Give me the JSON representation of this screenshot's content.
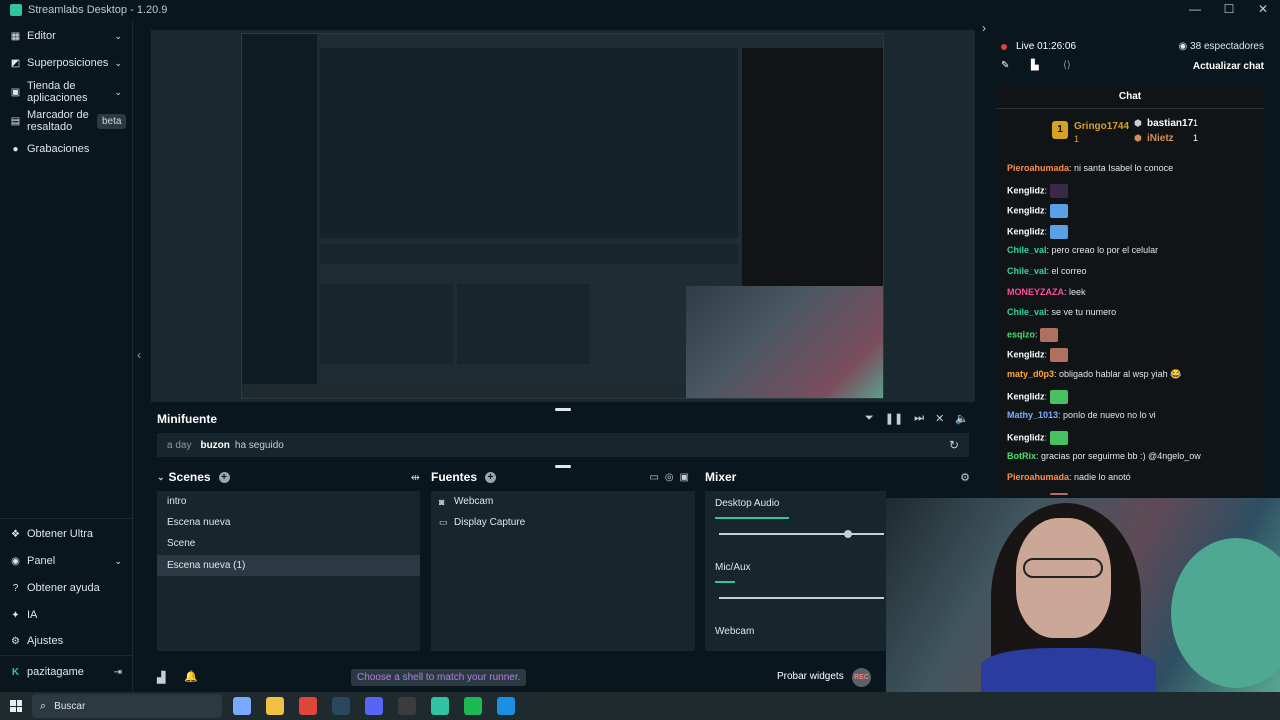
{
  "window": {
    "title": "Streamlabs Desktop - 1.20.9",
    "controls": [
      "—",
      "☐",
      "✕"
    ]
  },
  "sidebar": {
    "items": [
      {
        "label": "Editor",
        "icon": "grid-icon",
        "has_chevron": true
      },
      {
        "label": "Superposiciones",
        "icon": "overlay-icon",
        "has_chevron": true
      },
      {
        "label": "Tienda de aplicaciones",
        "icon": "store-icon",
        "has_chevron": true
      },
      {
        "label": "Marcador de resaltado",
        "icon": "highlight-icon",
        "badge": "beta"
      },
      {
        "label": "Grabaciones",
        "icon": "record-icon"
      }
    ],
    "bottom_items": [
      {
        "label": "Obtener Ultra",
        "icon": "ultra-icon"
      },
      {
        "label": "Panel",
        "icon": "panel-icon",
        "has_chevron": true
      },
      {
        "label": "Obtener ayuda",
        "icon": "help-icon"
      },
      {
        "label": "IA",
        "icon": "ai-icon"
      },
      {
        "label": "Ajustes",
        "icon": "settings-icon"
      }
    ],
    "user": {
      "name": "pazitagame",
      "logout_icon": "logout-icon"
    }
  },
  "minifeed": {
    "title": "Minifuente",
    "event": {
      "time": "a day",
      "user": "buzon",
      "action": "ha seguido"
    }
  },
  "scenes": {
    "title": "Scenes",
    "items": [
      "intro",
      "Escena nueva",
      "Scene",
      "Escena nueva (1)"
    ],
    "selected_index": 3
  },
  "sources": {
    "title": "Fuentes",
    "items": [
      {
        "label": "Webcam",
        "icon": "webcam-icon"
      },
      {
        "label": "Display Capture",
        "icon": "monitor-icon"
      }
    ]
  },
  "mixer": {
    "title": "Mixer",
    "channels": [
      {
        "label": "Desktop Audio",
        "level": 0.45,
        "volume": 0.78
      },
      {
        "label": "Mic/Aux",
        "level": 0.12,
        "volume": 1.0
      },
      {
        "label": "Webcam"
      }
    ]
  },
  "footer": {
    "shell_tip": "Choose a shell to match your runner.",
    "widgets_label": "Probar widgets",
    "rec_label": "REC"
  },
  "live": {
    "status": "Live 01:26:06",
    "viewers": "38 espectadores",
    "refresh_chat": "Actualizar chat"
  },
  "chat": {
    "title": "Chat",
    "gifters": [
      {
        "name": "Gringo1744",
        "count": "1",
        "rank": "1"
      },
      {
        "name": "bastian17",
        "count": "1"
      },
      {
        "name": "iNietz",
        "count": "1"
      }
    ],
    "messages": [
      {
        "user": "Pieroahumada",
        "color": "#ff8c4a",
        "text": "ni santa Isabel lo conoce"
      },
      {
        "user": "Kenglidz",
        "color": "#ffffff",
        "text": "",
        "emote": "#3a2a4a"
      },
      {
        "user": "Kenglidz",
        "color": "#ffffff",
        "text": "",
        "emote": "#5aa0e6"
      },
      {
        "user": "Kenglidz",
        "color": "#ffffff",
        "text": "",
        "emote": "#5aa0e6"
      },
      {
        "user": "Chile_val",
        "color": "#31d6a2",
        "text": "pero creao lo por el celular"
      },
      {
        "user": "Chile_val",
        "color": "#31d6a2",
        "text": "el correo"
      },
      {
        "user": "MONEYZAZA",
        "color": "#ff4da0",
        "text": "leek"
      },
      {
        "user": "Chile_val",
        "color": "#31d6a2",
        "text": "se ve tu numero"
      },
      {
        "user": "esqizo",
        "color": "#48e06a",
        "text": "",
        "emote": "#b07060"
      },
      {
        "user": "Kenglidz",
        "color": "#ffffff",
        "text": "",
        "emote": "#b07060"
      },
      {
        "user": "maty_d0p3",
        "color": "#ffa838",
        "text": "obligado hablar al wsp yiah 😂"
      },
      {
        "user": "Kenglidz",
        "color": "#ffffff",
        "text": "",
        "emote": "#48c060"
      },
      {
        "user": "Mathy_1013",
        "color": "#7fb0ff",
        "text": "ponlo de nuevo no lo vi"
      },
      {
        "user": "Kenglidz",
        "color": "#ffffff",
        "text": "",
        "emote": "#48c060"
      },
      {
        "user": "BotRix",
        "color": "#48e06a",
        "text": "gracias por seguirme bb :) @4ngelo_ow"
      },
      {
        "user": "Pieroahumada",
        "color": "#ff8c4a",
        "text": "nadie lo anotó"
      },
      {
        "user": "Kenglidz",
        "color": "#ffffff",
        "text": "",
        "emote": "#b07060"
      }
    ]
  },
  "taskbar": {
    "search_label": "Buscar",
    "apps": [
      "copilot-icon",
      "folder-icon",
      "chrome-icon",
      "steam-icon",
      "discord-icon",
      "obs-icon",
      "streamlabs-icon",
      "spotify-icon",
      "edge-icon"
    ]
  },
  "colors": {
    "accent": "#31c3a2",
    "bg": "#09161d",
    "panel": "#17252c",
    "live": "#e53d3d"
  }
}
